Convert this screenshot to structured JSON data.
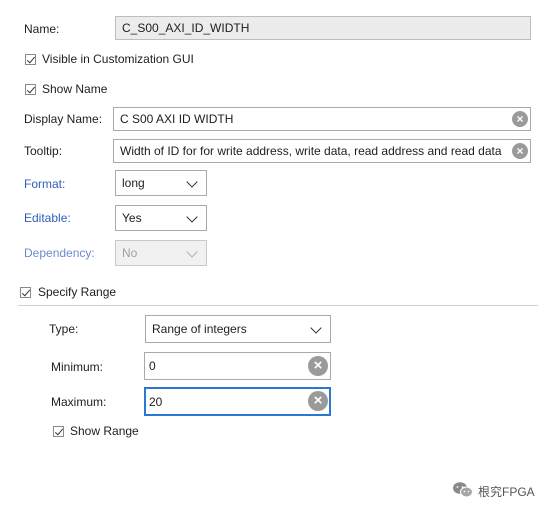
{
  "fields": {
    "name": {
      "label": "Name:",
      "value": "C_S00_AXI_ID_WIDTH"
    },
    "visible_in_gui": {
      "label": "Visible in Customization GUI",
      "checked": true
    },
    "show_name": {
      "label": "Show Name",
      "checked": true
    },
    "display_name": {
      "label": "Display Name:",
      "value": "C S00 AXI ID WIDTH"
    },
    "tooltip": {
      "label": "Tooltip:",
      "value": "Width of ID for for write address, write data, read address and read data"
    },
    "format": {
      "label": "Format:",
      "value": "long"
    },
    "editable": {
      "label": "Editable:",
      "value": "Yes"
    },
    "dependency": {
      "label": "Dependency:",
      "value": "No"
    },
    "specify_range": {
      "label": "Specify Range",
      "checked": true
    }
  },
  "range": {
    "type": {
      "label": "Type:",
      "value": "Range of integers"
    },
    "minimum": {
      "label": "Minimum:",
      "value": "0"
    },
    "maximum": {
      "label": "Maximum:",
      "value": "20"
    },
    "show_range": {
      "label": "Show Range",
      "checked": true
    }
  },
  "icons": {
    "clear": "×",
    "checkbox_checked": "check-icon",
    "dropdown": "chevron-down-icon"
  },
  "watermark": {
    "text": "根究FPGA",
    "icon": "wechat-icon"
  },
  "colors": {
    "link": "#2f5fb8",
    "focus": "#2b78d0",
    "readonly_bg": "#ececec"
  }
}
